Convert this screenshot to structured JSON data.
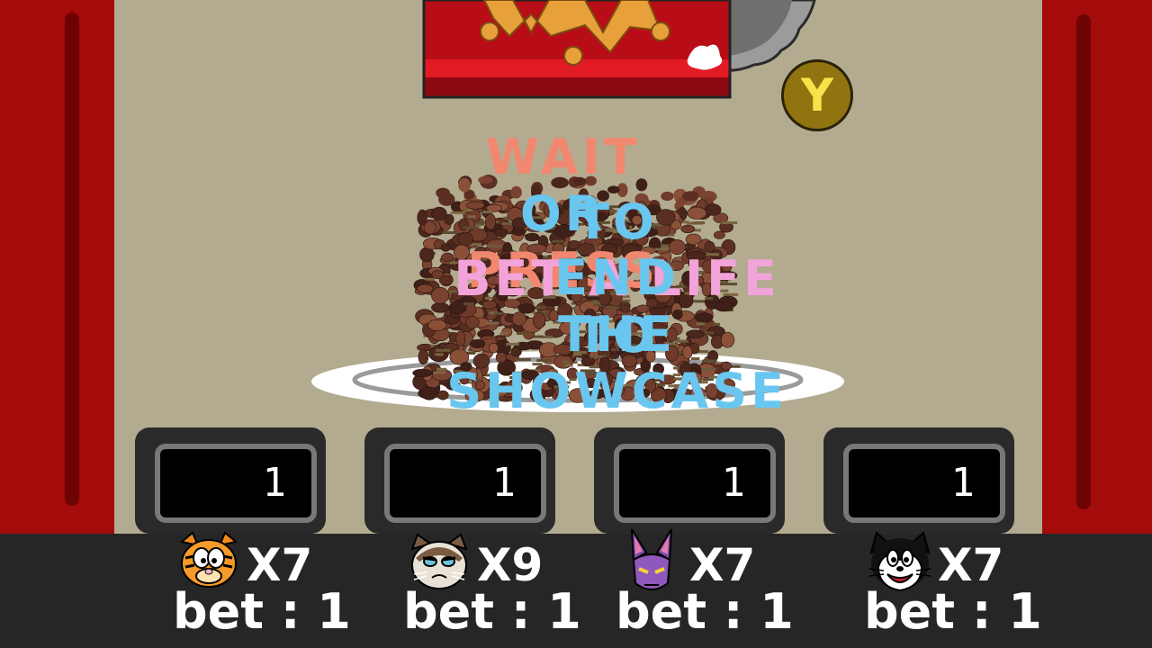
{
  "prompt": {
    "line1": [
      {
        "text": "WAIT",
        "color": "salmon"
      },
      {
        "text": "OR",
        "color": "blue"
      },
      {
        "text": "PRESS",
        "color": "salmon"
      }
    ],
    "button": "Y",
    "line2": [
      {
        "text": "TO",
        "color": "blue"
      },
      {
        "text": "BET A LIFE",
        "color": "pink"
      },
      {
        "text": "TO",
        "color": "blue"
      }
    ],
    "line3": [
      {
        "text": "END",
        "color": "blue"
      },
      {
        "text": "THE",
        "color": "blue"
      },
      {
        "text": "SHOWCASE",
        "color": "blue"
      }
    ]
  },
  "counters": [
    "1",
    "1",
    "1",
    "1"
  ],
  "players": [
    {
      "character": "orange-cat",
      "lives": "X7",
      "bet": "bet : 1"
    },
    {
      "character": "grumpy-cat",
      "lives": "X9",
      "bet": "bet : 1"
    },
    {
      "character": "purple-cat",
      "lives": "X7",
      "bet": "bet : 1"
    },
    {
      "character": "black-white-cat",
      "lives": "X7",
      "bet": "bet : 1"
    }
  ],
  "colors": {
    "salmon": "#f2876f",
    "blue": "#69c6ef",
    "pink": "#f2a3d9",
    "curtain": "#a40b0b",
    "wall": "#b3ab90",
    "button_gold": "#8f7410",
    "button_letter": "#f7e24a"
  }
}
